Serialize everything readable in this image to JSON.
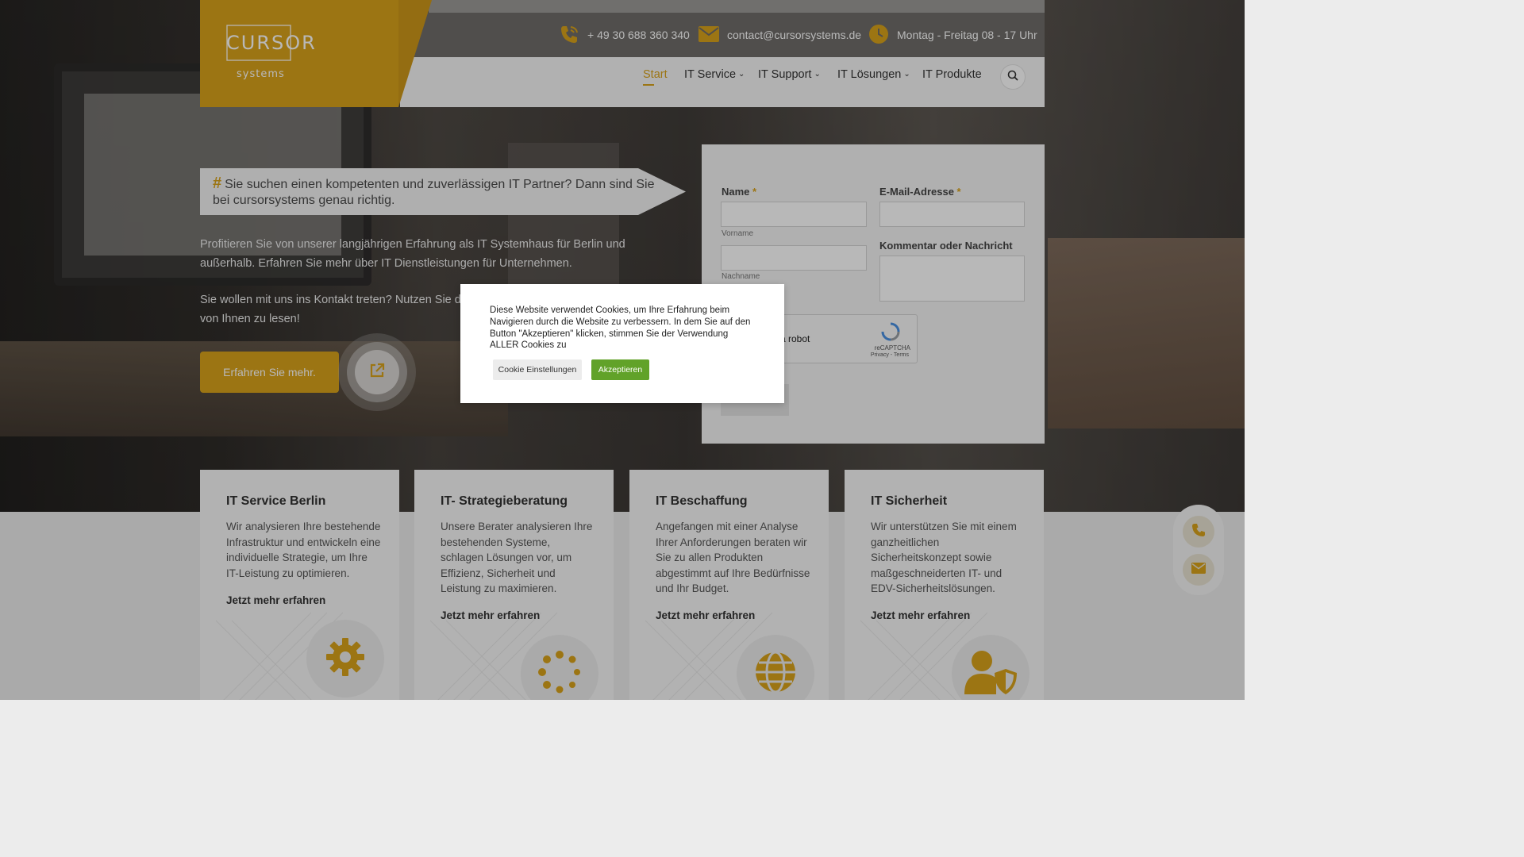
{
  "brand": {
    "logo_word": "CURSOR",
    "logo_sub": "systems",
    "accent_color": "#d9a21b"
  },
  "topbar": {
    "phone": "+ 49 30 688 360 340",
    "email": "contact@cursorsystems.de",
    "hours": "Montag - Freitag 08 - 17 Uhr"
  },
  "nav": {
    "items": [
      {
        "label": "Start",
        "active": true
      },
      {
        "label": "IT Service",
        "has_dropdown": true
      },
      {
        "label": "IT Support",
        "has_dropdown": true
      },
      {
        "label": "IT Lösungen",
        "has_dropdown": true
      },
      {
        "label": "IT Produkte"
      }
    ],
    "search_icon": "search-icon"
  },
  "hero": {
    "tagline_hash": "#",
    "tagline": "Sie suchen einen kompetenten und zuverlässigen IT Partner? Dann sind Sie bei cursorsystems genau richtig.",
    "paragraph1": "Profitieren Sie von unserer langjährigen Erfahrung als IT Systemhaus für Berlin und außerhalb. Erfahren Sie mehr über IT Dienstleistungen für Unternehmen.",
    "paragraph2": "Sie wollen mit uns ins Kontakt treten? Nutzen Sie da von Ihnen zu lesen!",
    "cta_label": "Erfahren Sie mehr."
  },
  "form": {
    "name_label": "Name",
    "email_label": "E-Mail-Adresse",
    "required_mark": "*",
    "first_name_sub": "Vorname",
    "last_name_sub": "Nachname",
    "message_label": "Kommentar oder Nachricht",
    "recaptcha_text": "a robot",
    "recaptcha_brand": "reCAPTCHA",
    "recaptcha_terms": "Privacy - Terms"
  },
  "cards": [
    {
      "title": "IT Service Berlin",
      "text": "Wir analysieren Ihre bestehende Infrastruktur und entwickeln eine individuelle Strategie, um Ihre IT-Leistung zu optimieren.",
      "link": "Jetzt mehr erfahren",
      "icon": "gear-icon"
    },
    {
      "title": "IT- Strategieberatung",
      "text": "Unsere Berater analysieren Ihre bestehenden Systeme, schlagen Lösungen vor, um Effizienz, Sicherheit und Leistung zu maximieren.",
      "link": "Jetzt mehr erfahren",
      "icon": "loading-dots-icon"
    },
    {
      "title": "IT Beschaffung",
      "text": "Angefangen mit einer Analyse Ihrer Anforderungen beraten wir Sie zu allen Produkten abgestimmt auf Ihre Bedürfnisse und Ihr Budget.",
      "link": "Jetzt mehr erfahren",
      "icon": "globe-icon"
    },
    {
      "title": "IT Sicherheit",
      "text": "Wir unterstützen Sie mit einem ganzheitlichen Sicherheitskonzept sowie maßgeschneiderten IT- und EDV-Sicherheitslösungen.",
      "link": "Jetzt mehr erfahren",
      "icon": "user-shield-icon"
    }
  ],
  "floating": {
    "phone_icon": "phone-icon",
    "mail_icon": "mail-icon"
  },
  "cookie": {
    "text": "Diese Website verwendet Cookies, um Ihre Erfahrung beim Navigieren durch die Website zu verbessern. In dem Sie auf den Button \"Akzeptieren\" klicken, stimmen Sie der Verwendung ALLER Cookies zu",
    "settings_label": "Cookie Einstellungen",
    "accept_label": "Akzeptieren",
    "accept_color": "#61a229"
  }
}
